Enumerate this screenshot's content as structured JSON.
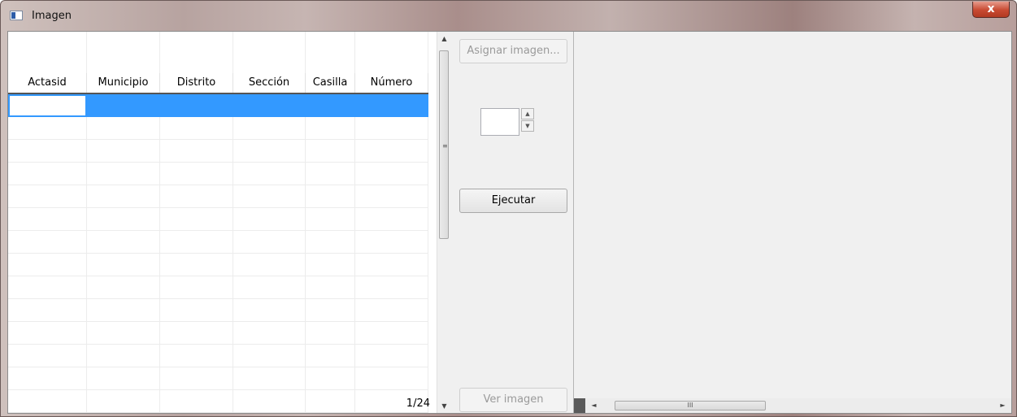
{
  "window": {
    "title": "Imagen",
    "close_glyph": "x"
  },
  "table": {
    "columns": [
      "Actasid",
      "Municipio",
      "Distrito",
      "Sección",
      "Casilla",
      "Número"
    ],
    "page_label": "1/24"
  },
  "panel": {
    "assign_button": "Asignar imagen...",
    "run_button": "Ejecutar",
    "view_button": "Ver imagen",
    "spin_value": ""
  },
  "scroll": {
    "v_up": "▲",
    "v_down": "▼",
    "v_grip": "≡",
    "h_left": "◄",
    "h_right": "►",
    "h_grip": "III"
  },
  "colors": {
    "selection": "#3399ff"
  }
}
